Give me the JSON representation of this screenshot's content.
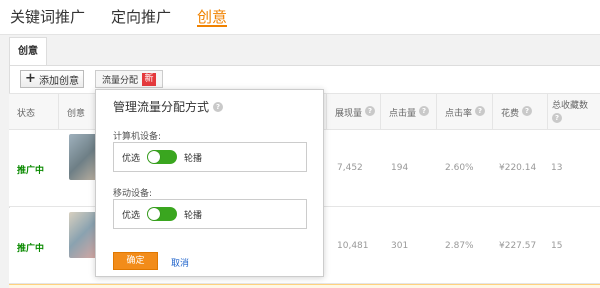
{
  "top_tabs": [
    {
      "label": "关键词推广",
      "active": false
    },
    {
      "label": "定向推广",
      "active": false
    },
    {
      "label": "创意",
      "active": true
    }
  ],
  "sub_tab": {
    "label": "创意"
  },
  "toolbar": {
    "add_label": "添加创意",
    "flow_label": "流量分配",
    "flow_badge": "新"
  },
  "table": {
    "headers": {
      "status": "状态",
      "creative": "创意",
      "impressions": "展现量",
      "clicks": "点击量",
      "ctr": "点击率",
      "cost": "花费",
      "favorites": "总收藏数"
    },
    "rows": [
      {
        "status": "推广中",
        "impressions": "7,452",
        "clicks": "194",
        "ctr": "2.60%",
        "cost": "¥220.14",
        "favorites": "13"
      },
      {
        "status": "推广中",
        "impressions": "10,481",
        "clicks": "301",
        "ctr": "2.87%",
        "cost": "¥227.57",
        "favorites": "15"
      }
    ]
  },
  "popup": {
    "title": "管理流量分配方式",
    "computer_label": "计算机设备:",
    "mobile_label": "移动设备:",
    "optimize_label": "优选",
    "rotate_label": "轮播",
    "confirm_label": "确定",
    "cancel_label": "取消"
  },
  "colors": {
    "accent": "#f08200",
    "status_green": "#0a8a00",
    "toggle_green": "#3aa61f",
    "badge_red": "#e4393c",
    "link_blue": "#2266cc"
  }
}
